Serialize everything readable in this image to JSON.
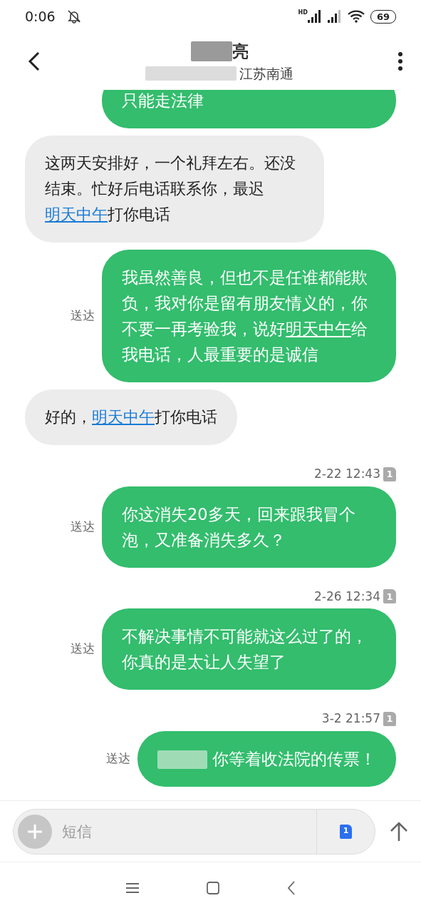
{
  "status_bar": {
    "time": "0:06",
    "network": "HD",
    "battery": "69"
  },
  "header": {
    "name": "亮",
    "location": "江苏南通"
  },
  "messages": [
    {
      "kind": "sent",
      "clipped": true,
      "parts": [
        {
          "kind": "text",
          "text": "只能走法律"
        }
      ]
    },
    {
      "kind": "received",
      "parts": [
        {
          "kind": "text",
          "text": "这两天安排好，一个礼拜左右。还没结束。忙好后电话联系你，最迟"
        },
        {
          "kind": "link",
          "text": "明天中午"
        },
        {
          "kind": "text",
          "text": "打你电话"
        }
      ]
    },
    {
      "kind": "sent",
      "status": "送达",
      "parts": [
        {
          "kind": "text",
          "text": "我虽然善良，但也不是任谁都能欺负，我对你是留有朋友情义的，你不要一再考验我，说好"
        },
        {
          "kind": "link",
          "text": "明天中午"
        },
        {
          "kind": "text",
          "text": "给我电话，人最重要的是诚信"
        }
      ]
    },
    {
      "kind": "received",
      "parts": [
        {
          "kind": "text",
          "text": "好的，"
        },
        {
          "kind": "link",
          "text": "明天中午"
        },
        {
          "kind": "text",
          "text": "打你电话"
        }
      ]
    },
    {
      "kind": "timestamp",
      "time": "2-22 12:43",
      "sim": "1"
    },
    {
      "kind": "sent",
      "status": "送达",
      "parts": [
        {
          "kind": "text",
          "text": "你这消失20多天，回来跟我冒个泡，又准备消失多久？"
        }
      ]
    },
    {
      "kind": "timestamp",
      "time": "2-26 12:34",
      "sim": "1"
    },
    {
      "kind": "sent",
      "status": "送达",
      "parts": [
        {
          "kind": "text",
          "text": "不解决事情不可能就这么过了的，你真的是太让人失望了"
        }
      ]
    },
    {
      "kind": "timestamp",
      "time": "3-2 21:57",
      "sim": "1"
    },
    {
      "kind": "sent",
      "status": "送达",
      "parts": [
        {
          "kind": "redacted"
        },
        {
          "kind": "text",
          "text": " 你等着收法院的传票！"
        }
      ]
    }
  ],
  "composer": {
    "placeholder": "短信",
    "sim": "1"
  }
}
